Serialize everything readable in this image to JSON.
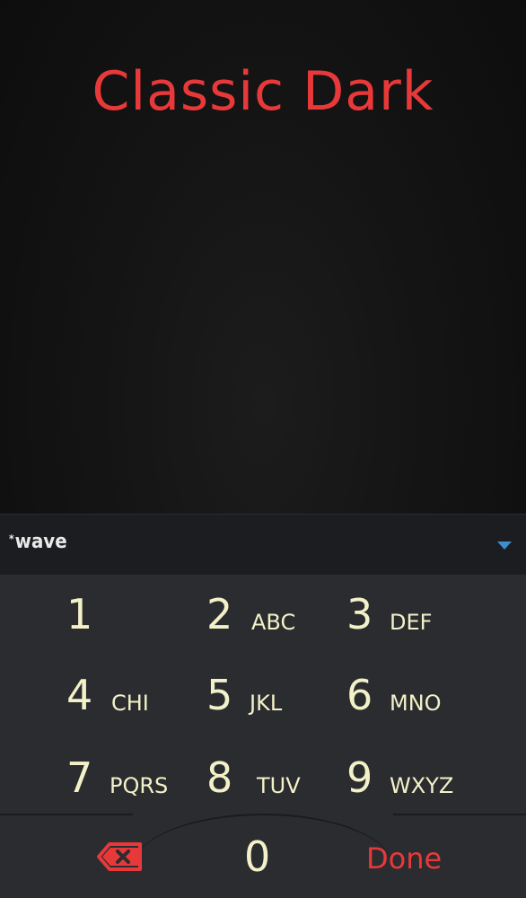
{
  "theme": {
    "title": "Classic Dark",
    "accent_color": "#e8393a",
    "key_text_color": "#f3f1c8",
    "toolbar_icon_color": "#3d8ec9"
  },
  "toolbar": {
    "brand_star": "*",
    "brand_text": "wave",
    "collapse_icon": "chevron-down-icon"
  },
  "keys": [
    {
      "digit": "1",
      "letters": ""
    },
    {
      "digit": "2",
      "letters": "ABC"
    },
    {
      "digit": "3",
      "letters": "DEF"
    },
    {
      "digit": "4",
      "letters": "CHI"
    },
    {
      "digit": "5",
      "letters": "JKL"
    },
    {
      "digit": "6",
      "letters": "MNO"
    },
    {
      "digit": "7",
      "letters": "PQRS"
    },
    {
      "digit": "8",
      "letters": "TUV"
    },
    {
      "digit": "9",
      "letters": "WXYZ"
    }
  ],
  "bottom": {
    "backspace_icon": "backspace-icon",
    "zero": "0",
    "done_label": "Done"
  }
}
